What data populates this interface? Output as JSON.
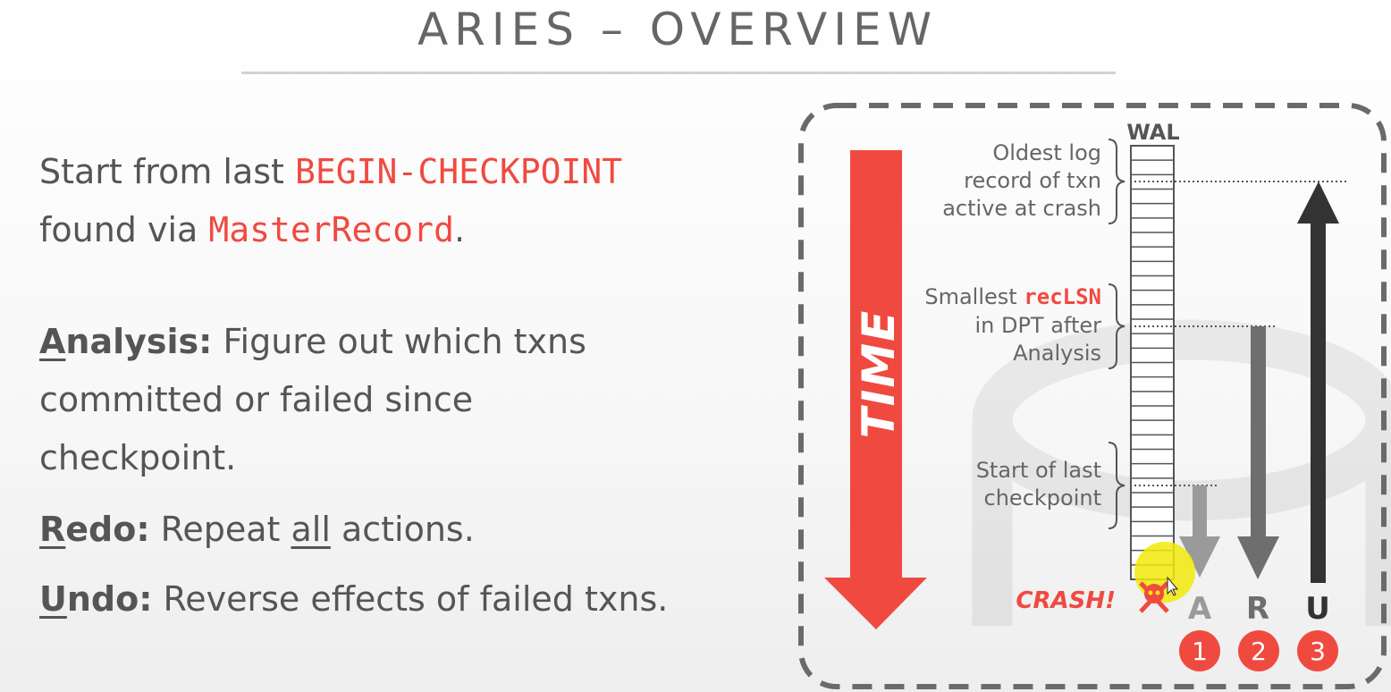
{
  "title": "ARIES – OVERVIEW",
  "intro": {
    "line1_prefix": "Start from last ",
    "line1_keyword": "BEGIN-CHECKPOINT",
    "line2_prefix": "found via ",
    "line2_keyword": "MasterRecord",
    "line2_suffix": "."
  },
  "phases": {
    "analysis": {
      "initial": "A",
      "rest": "nalysis:",
      "line1": " Figure out which txns",
      "line2": "committed or failed since",
      "line3": "checkpoint."
    },
    "redo": {
      "initial": "R",
      "rest": "edo:",
      "text_pre": " Repeat ",
      "text_emph": "all",
      "text_post": " actions."
    },
    "undo": {
      "initial": "U",
      "rest": "ndo:",
      "text": " Reverse effects of failed txns."
    }
  },
  "diagram": {
    "time_label": "TIME",
    "wal_label": "WAL",
    "annotation_oldest": [
      "Oldest log",
      "record of txn",
      "active at crash"
    ],
    "annotation_reclsn_prefix": "Smallest ",
    "annotation_reclsn_keyword": "recLSN",
    "annotation_reclsn_rest": [
      "in DPT after",
      "Analysis"
    ],
    "annotation_checkpoint": [
      "Start of last",
      "checkpoint"
    ],
    "crash_label": "CRASH!",
    "arrows": [
      {
        "letter": "A",
        "step": "1"
      },
      {
        "letter": "R",
        "step": "2"
      },
      {
        "letter": "U",
        "step": "3"
      }
    ],
    "colors": {
      "accent_red": "#f04a40",
      "arrow_analysis": "#9a9a9a",
      "arrow_redo": "#6e6e6e",
      "arrow_undo": "#333333",
      "cursor_highlight": "#f2ea0a"
    }
  }
}
